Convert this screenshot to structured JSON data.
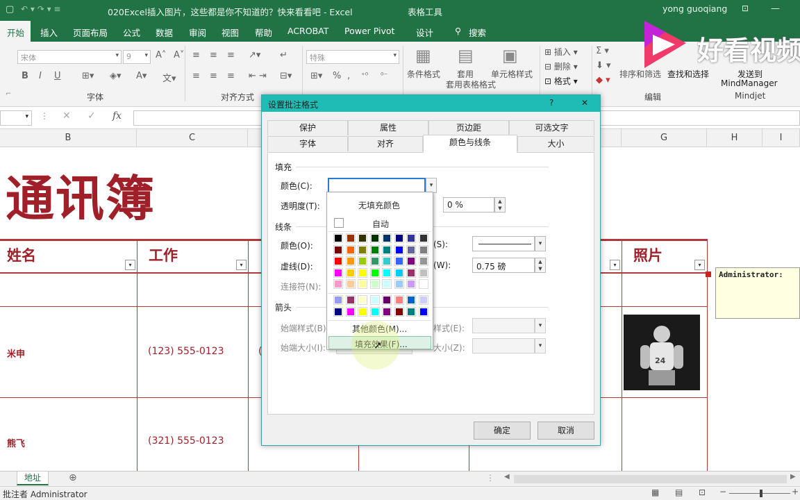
{
  "window": {
    "doc_title": "020Excel插入图片，这些都是你不知道的？快来看看吧 - Excel",
    "table_tools": "表格工具",
    "user": "yong guoqiang"
  },
  "ribbon_tabs": [
    "开始",
    "插入",
    "页面布局",
    "公式",
    "数据",
    "审阅",
    "视图",
    "帮助",
    "ACROBAT",
    "Power Pivot",
    "设计",
    "搜索"
  ],
  "ribbon": {
    "font_name": "宋体",
    "font_size": "9",
    "number_format": "特殊",
    "group_font": "字体",
    "group_align": "对齐方式",
    "group_edit": "编辑",
    "cond_format": "条件格式",
    "table_format": "套用表格格式",
    "cell_style": "单元格样式",
    "insert": "插入",
    "delete": "删除",
    "format": "格式",
    "sort_filter": "排序和筛选",
    "find_select": "查找和选择",
    "send_to": "发送到",
    "mindmanager": "MindManager",
    "mindjet": "Mindjet",
    "percent": "%"
  },
  "watermark": "好看视频",
  "formula_bar": {
    "fx": "fx"
  },
  "columns": [
    "B",
    "C",
    "G",
    "H",
    "I"
  ],
  "sheet": {
    "big_title": "通讯簿",
    "header_name": "姓名",
    "header_job": "工作",
    "header_photo": "照片",
    "rows": [
      {
        "name": "米申",
        "phone": "(123) 555-0123"
      },
      {
        "name": "熊飞",
        "phone": "(321) 555-0123"
      }
    ],
    "comment_author": "Administrator:"
  },
  "sheet_tab": "地址",
  "status": "批注者 Administrator",
  "dialog": {
    "title": "设置批注格式",
    "help": "?",
    "close": "✕",
    "tabs_row1": [
      "保护",
      "属性",
      "页边距",
      "可选文字"
    ],
    "tabs_row2": [
      "字体",
      "对齐",
      "颜色与线条",
      "大小"
    ],
    "fill_section": "填充",
    "color_label": "颜色(C):",
    "transparency_label": "透明度(T):",
    "transparency_value": "0 %",
    "line_section": "线条",
    "line_color_label": "颜色(O):",
    "dash_label": "虚线(D):",
    "connector_label": "连接符(N):",
    "style_label": "(S):",
    "weight_label": "(W):",
    "weight_value": "0.75 磅",
    "arrow_section": "箭头",
    "start_style_label": "始端样式(B)",
    "start_size_label": "始端大小(I):",
    "end_style_label": "样式(E):",
    "end_size_label": "大小(Z):",
    "ok": "确定",
    "cancel": "取消"
  },
  "color_popup": {
    "no_fill": "无填充颜色",
    "auto": "自动",
    "more_colors": "其他颜色(M)...",
    "fill_effects": "填充效果(F)...",
    "grid": [
      [
        "#000000",
        "#993300",
        "#333300",
        "#003300",
        "#003366",
        "#000080",
        "#333399",
        "#333333"
      ],
      [
        "#800000",
        "#FF6600",
        "#808000",
        "#008000",
        "#008080",
        "#0000FF",
        "#666699",
        "#808080"
      ],
      [
        "#FF0000",
        "#FF9900",
        "#99CC00",
        "#339966",
        "#33CCCC",
        "#3366FF",
        "#800080",
        "#969696"
      ],
      [
        "#FF00FF",
        "#FFCC00",
        "#FFFF00",
        "#00FF00",
        "#00FFFF",
        "#00CCFF",
        "#993366",
        "#C0C0C0"
      ],
      [
        "#FF99CC",
        "#FFCC99",
        "#FFFF99",
        "#CCFFCC",
        "#CCFFFF",
        "#99CCFF",
        "#CC99FF",
        "#FFFFFF"
      ]
    ],
    "grid2": [
      [
        "#9999FF",
        "#993366",
        "#FFFFCC",
        "#CCFFFF",
        "#660066",
        "#FF8080",
        "#0066CC",
        "#CCCCFF"
      ],
      [
        "#000080",
        "#FF00FF",
        "#FFFF00",
        "#00FFFF",
        "#800080",
        "#800000",
        "#008080",
        "#0000FF"
      ]
    ]
  }
}
